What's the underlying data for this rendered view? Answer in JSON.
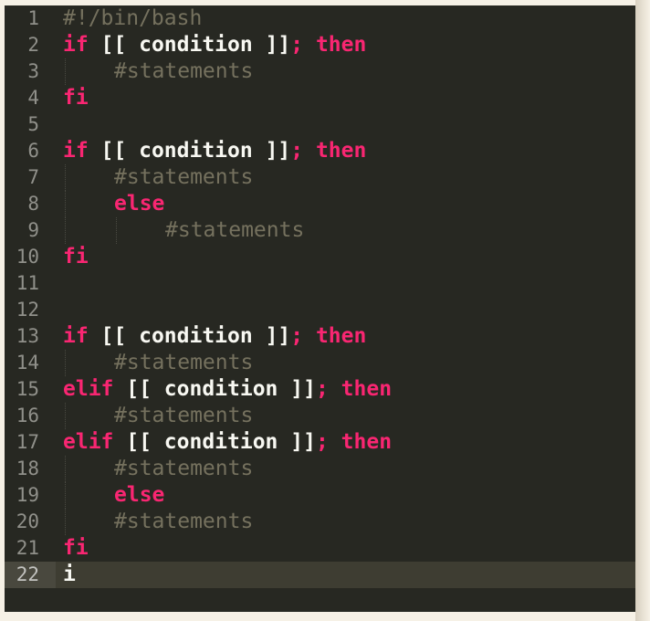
{
  "editor": {
    "lines": [
      {
        "num": "1",
        "tokens": [
          {
            "t": "cm",
            "v": "#!/bin/bash"
          }
        ]
      },
      {
        "num": "2",
        "tokens": [
          {
            "t": "kw",
            "v": "if"
          },
          {
            "t": "tx",
            "v": " [[ condition ]]"
          },
          {
            "t": "kw",
            "v": "; then"
          }
        ]
      },
      {
        "num": "3",
        "indent": 1,
        "tokens": [
          {
            "t": "cm",
            "v": "#statements"
          }
        ]
      },
      {
        "num": "4",
        "tokens": [
          {
            "t": "kw",
            "v": "fi"
          }
        ]
      },
      {
        "num": "5",
        "tokens": []
      },
      {
        "num": "6",
        "tokens": [
          {
            "t": "kw",
            "v": "if"
          },
          {
            "t": "tx",
            "v": " [[ condition ]]"
          },
          {
            "t": "kw",
            "v": "; then"
          }
        ]
      },
      {
        "num": "7",
        "indent": 1,
        "tokens": [
          {
            "t": "cm",
            "v": "#statements"
          }
        ]
      },
      {
        "num": "8",
        "indent": 1,
        "tokens": [
          {
            "t": "kw",
            "v": "else"
          }
        ]
      },
      {
        "num": "9",
        "indent": 2,
        "tokens": [
          {
            "t": "cm",
            "v": "#statements"
          }
        ]
      },
      {
        "num": "10",
        "tokens": [
          {
            "t": "kw",
            "v": "fi"
          }
        ]
      },
      {
        "num": "11",
        "tokens": []
      },
      {
        "num": "12",
        "tokens": []
      },
      {
        "num": "13",
        "tokens": [
          {
            "t": "kw",
            "v": "if"
          },
          {
            "t": "tx",
            "v": " [[ condition ]]"
          },
          {
            "t": "kw",
            "v": "; then"
          }
        ]
      },
      {
        "num": "14",
        "indent": 1,
        "tokens": [
          {
            "t": "cm",
            "v": "#statements"
          }
        ]
      },
      {
        "num": "15",
        "tokens": [
          {
            "t": "kw",
            "v": "elif"
          },
          {
            "t": "tx",
            "v": " [[ condition ]]"
          },
          {
            "t": "kw",
            "v": "; then"
          }
        ]
      },
      {
        "num": "16",
        "indent": 1,
        "tokens": [
          {
            "t": "cm",
            "v": "#statements"
          }
        ]
      },
      {
        "num": "17",
        "tokens": [
          {
            "t": "kw",
            "v": "elif"
          },
          {
            "t": "tx",
            "v": " [[ condition ]]"
          },
          {
            "t": "kw",
            "v": "; then"
          }
        ]
      },
      {
        "num": "18",
        "indent": 1,
        "tokens": [
          {
            "t": "cm",
            "v": "#statements"
          }
        ]
      },
      {
        "num": "19",
        "indent": 1,
        "tokens": [
          {
            "t": "kw",
            "v": "else"
          }
        ]
      },
      {
        "num": "20",
        "indent": 1,
        "tokens": [
          {
            "t": "cm",
            "v": "#statements"
          }
        ]
      },
      {
        "num": "21",
        "tokens": [
          {
            "t": "kw",
            "v": "fi"
          }
        ]
      },
      {
        "num": "22",
        "current": true,
        "tokens": [
          {
            "t": "tx",
            "v": "i"
          }
        ]
      }
    ],
    "colors": {
      "background": "#272822",
      "keyword": "#f92672",
      "comment": "#75715e",
      "text": "#f8f8f2",
      "line_number": "#90908a"
    }
  }
}
